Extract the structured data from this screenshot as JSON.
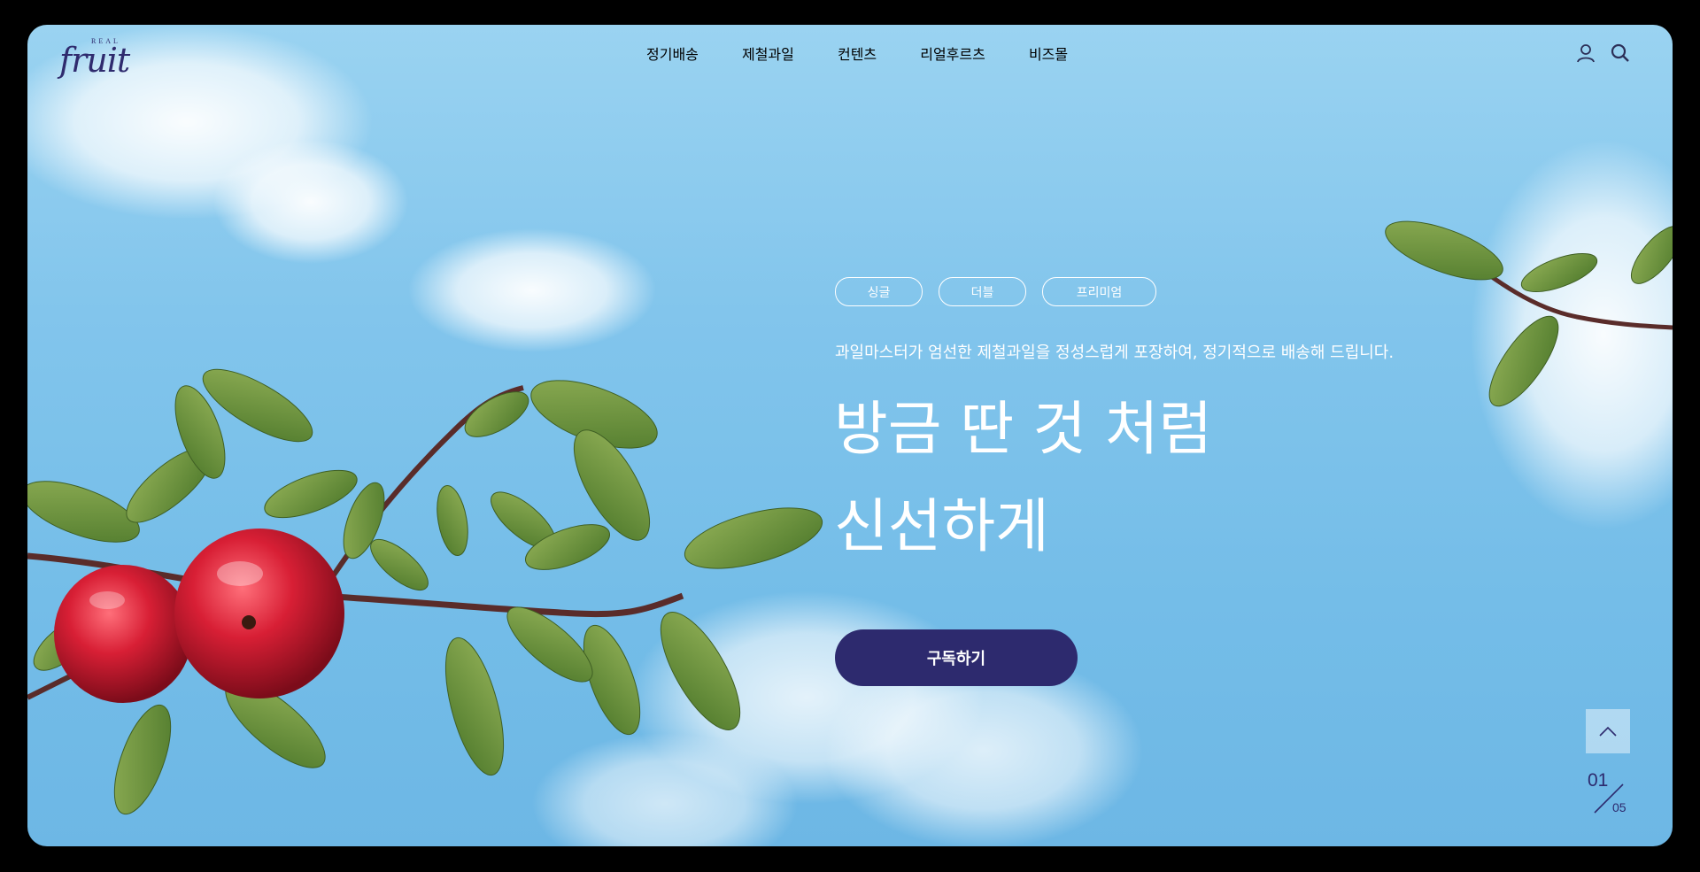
{
  "brand": {
    "logo_small": "REAL",
    "logo_main": "fruit"
  },
  "nav": {
    "items": [
      {
        "label": "정기배송"
      },
      {
        "label": "제철과일"
      },
      {
        "label": "컨텐츠"
      },
      {
        "label": "리얼후르츠"
      },
      {
        "label": "비즈몰"
      }
    ]
  },
  "header_icons": {
    "user": "user-icon",
    "search": "search-icon"
  },
  "hero": {
    "chips": [
      "싱글",
      "더블",
      "프리미엄"
    ],
    "subtitle": "과일마스터가 엄선한 제철과일을 정성스럽게 포장하여, 정기적으로 배송해 드립니다.",
    "headline_line1": "방금 딴 것 처럼",
    "headline_line2": "신선하게",
    "cta_label": "구독하기"
  },
  "slider": {
    "current": "01",
    "total": "05"
  },
  "colors": {
    "accent": "#2d2a6e",
    "sky": "#82c5ec",
    "text_light": "#ffffff"
  }
}
